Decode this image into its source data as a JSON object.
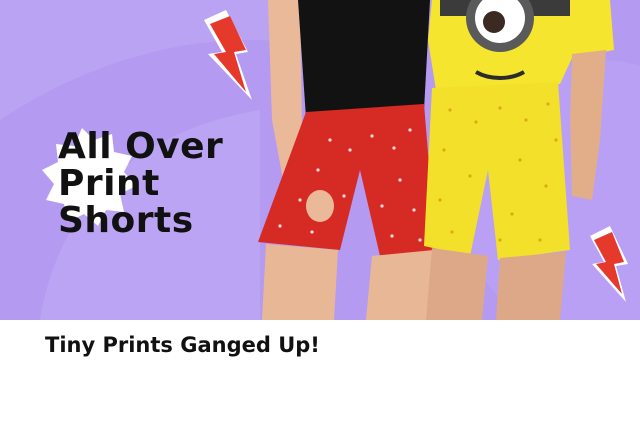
{
  "banner": {
    "headline_line1": "All Over",
    "headline_line2": "Print",
    "headline_line3": "Shorts",
    "background_color": "#b79cf3",
    "accent_color": "#e5392b",
    "image_description_icons": [
      "lightning-bolt-icon",
      "starburst-badge-icon"
    ]
  },
  "caption": {
    "text": "Tiny Prints Ganged Up!"
  }
}
